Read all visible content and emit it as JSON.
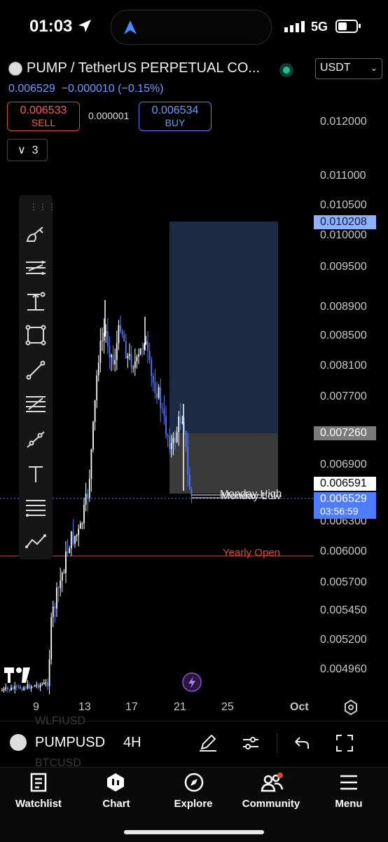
{
  "status": {
    "time": "01:03",
    "network": "5G"
  },
  "header": {
    "symbol_title": "PUMP / TetherUS PERPETUAL CO...",
    "currency": "USDT",
    "last_price": "0.006529",
    "change": "−0.000010 (−0.15%)",
    "sell": {
      "price": "0.006533",
      "label": "SELL"
    },
    "buy": {
      "price": "0.006534",
      "label": "BUY"
    },
    "spread": "0.000001",
    "collapse_count": "3"
  },
  "price_axis": {
    "labels": [
      "0.012000",
      "0.011000",
      "0.010500",
      "0.010000",
      "0.009500",
      "0.008900",
      "0.008500",
      "0.008100",
      "0.007700",
      "0.006900",
      "0.006300",
      "0.006000",
      "0.005700",
      "0.005450",
      "0.005200",
      "0.004960"
    ],
    "tp_price": "0.010208",
    "entry_price": "0.007260",
    "high_marker": "0.006591",
    "current_price": "0.006529",
    "countdown": "03:56:59"
  },
  "chart": {
    "levels": [
      "Monday High",
      "Monday Low",
      "Yearly Open"
    ],
    "colors": {
      "up": "#ffffff",
      "down": "#4f7cff",
      "yearly_open": "#e0443c",
      "target_zone": "#1c2a44",
      "entry_zone": "#3a3a3a"
    }
  },
  "time_axis": {
    "labels": [
      "9",
      "13",
      "17",
      "21",
      "25",
      "Oct"
    ]
  },
  "toolbar": {
    "tools": [
      "brush-icon",
      "parallel-lines-icon",
      "price-range-icon",
      "rectangle-icon",
      "trend-line-icon",
      "fib-retracement-icon",
      "ray-icon",
      "text-icon",
      "horizontal-lines-icon",
      "path-icon"
    ]
  },
  "bottom": {
    "pair": "PUMPUSD",
    "timeframe": "4H",
    "ghost_above": "WLFIUSD",
    "ghost_below": "BTCUSD"
  },
  "tabs": [
    "Watchlist",
    "Chart",
    "Explore",
    "Community",
    "Menu"
  ]
}
